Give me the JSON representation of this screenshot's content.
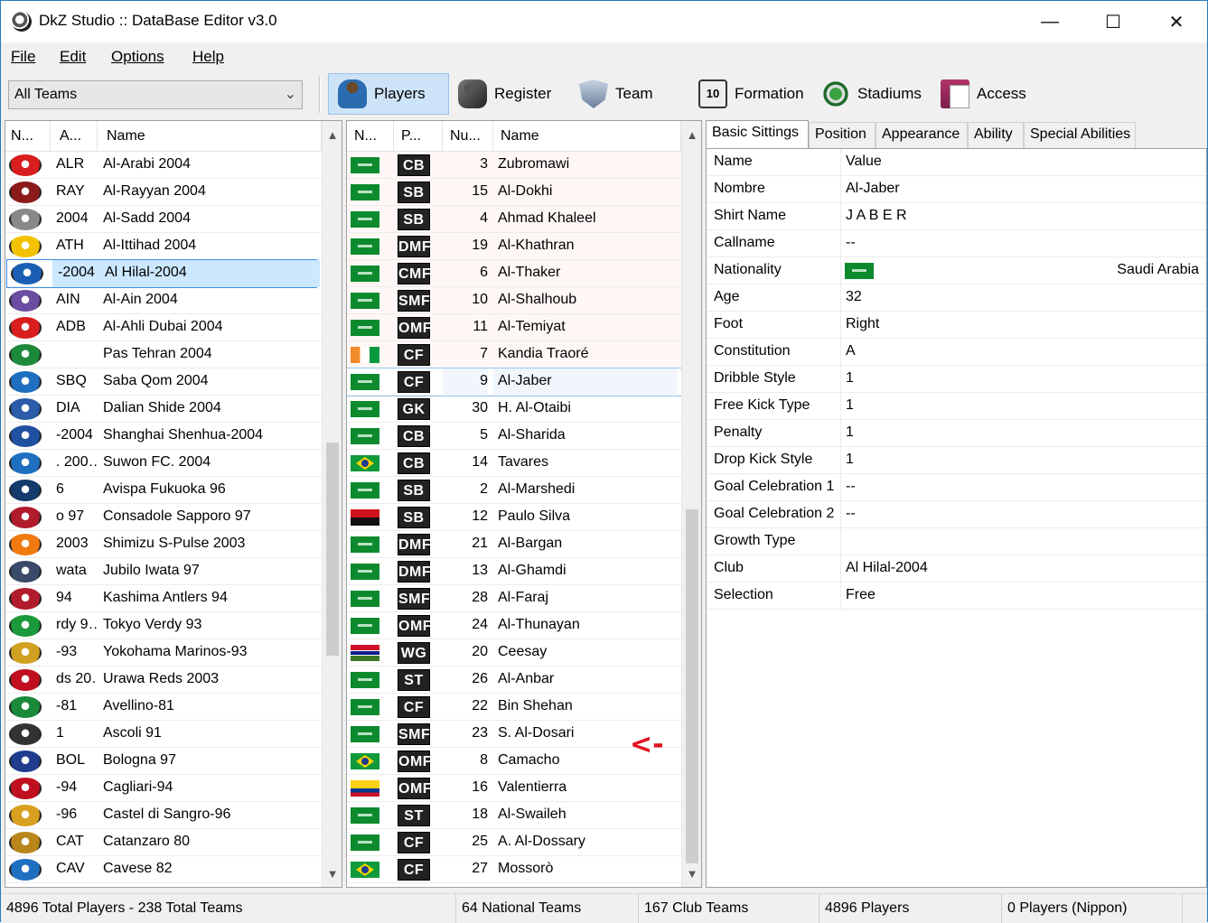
{
  "window": {
    "title": "DkZ Studio :: DataBase Editor v3.0",
    "minimize": "—",
    "maximize": "☐",
    "close": "✕"
  },
  "menu": {
    "file": "File",
    "edit": "Edit",
    "options": "Options",
    "help": "Help"
  },
  "toolbar": {
    "team_filter": "All Teams",
    "players": "Players",
    "register": "Register",
    "team": "Team",
    "formation": "Formation",
    "stadiums": "Stadiums",
    "access": "Access",
    "formation_icon_text": "10"
  },
  "teams_grid": {
    "headers": [
      "N...",
      "A...",
      "Name"
    ],
    "selected_index": 4,
    "rows": [
      {
        "abbr": "ALR",
        "name": "Al-Arabi 2004",
        "color": "#d81e1e"
      },
      {
        "abbr": "RAY",
        "name": "Al-Rayyan 2004",
        "color": "#8b1a1a"
      },
      {
        "abbr": "2004",
        "name": "Al-Sadd 2004",
        "color": "#888888"
      },
      {
        "abbr": "ATH",
        "name": "Al-Ittihad 2004",
        "color": "#f2c200"
      },
      {
        "abbr": "-2004",
        "name": "Al Hilal-2004",
        "color": "#1a5fb4"
      },
      {
        "abbr": "AIN",
        "name": "Al-Ain 2004",
        "color": "#6a4ca0"
      },
      {
        "abbr": "ADB",
        "name": "Al-Ahli Dubai 2004",
        "color": "#d81e1e"
      },
      {
        "abbr": "",
        "name": "Pas Tehran 2004",
        "color": "#1c8a3a"
      },
      {
        "abbr": "SBQ",
        "name": "Saba Qom 2004",
        "color": "#1f6fc0"
      },
      {
        "abbr": "DIA",
        "name": "Dalian Shide 2004",
        "color": "#2a5ca8"
      },
      {
        "abbr": "-2004",
        "name": "Shanghai Shenhua-2004",
        "color": "#2050a0"
      },
      {
        "abbr": ". 200…",
        "name": "Suwon FC. 2004",
        "color": "#1f6fc0"
      },
      {
        "abbr": "6",
        "name": "Avispa Fukuoka 96",
        "color": "#123a6a"
      },
      {
        "abbr": "o 97",
        "name": "Consadole Sapporo 97",
        "color": "#b01c2c"
      },
      {
        "abbr": "2003",
        "name": "Shimizu S-Pulse 2003",
        "color": "#f07a10"
      },
      {
        "abbr": "wata",
        "name": "Jubilo Iwata 97",
        "color": "#3a4a6a"
      },
      {
        "abbr": "94",
        "name": "Kashima Antlers 94",
        "color": "#b01c2c"
      },
      {
        "abbr": "rdy 9…",
        "name": "Tokyo Verdy 93",
        "color": "#1a9a3a"
      },
      {
        "abbr": "-93",
        "name": "Yokohama Marinos-93",
        "color": "#d0a020"
      },
      {
        "abbr": "ds 20…",
        "name": "Urawa Reds 2003",
        "color": "#c01020"
      },
      {
        "abbr": "-81",
        "name": "Avellino-81",
        "color": "#1a8a3a"
      },
      {
        "abbr": "1",
        "name": "Ascoli 91",
        "color": "#333333"
      },
      {
        "abbr": "BOL",
        "name": "Bologna 97",
        "color": "#1f3c8f"
      },
      {
        "abbr": "-94",
        "name": "Cagliari-94",
        "color": "#c01020"
      },
      {
        "abbr": "-96",
        "name": "Castel di Sangro-96",
        "color": "#d8a020"
      },
      {
        "abbr": "CAT",
        "name": "Catanzaro 80",
        "color": "#b8861a"
      },
      {
        "abbr": "CAV",
        "name": "Cavese 82",
        "color": "#1f6fc0"
      }
    ]
  },
  "players_grid": {
    "headers": [
      "N...",
      "P...",
      "Nu...",
      "Name"
    ],
    "selected_index": 8,
    "rows": [
      {
        "flag": "sa",
        "pos": "CB",
        "num": "3",
        "name": "Zubromawi"
      },
      {
        "flag": "sa",
        "pos": "SB",
        "num": "15",
        "name": "Al-Dokhi"
      },
      {
        "flag": "sa",
        "pos": "SB",
        "num": "4",
        "name": "Ahmad Khaleel"
      },
      {
        "flag": "sa",
        "pos": "DMF",
        "num": "19",
        "name": "Al-Khathran"
      },
      {
        "flag": "sa",
        "pos": "CMF",
        "num": "6",
        "name": "Al-Thaker"
      },
      {
        "flag": "sa",
        "pos": "SMF",
        "num": "10",
        "name": "Al-Shalhoub"
      },
      {
        "flag": "sa",
        "pos": "OMF",
        "num": "11",
        "name": "Al-Temiyat"
      },
      {
        "flag": "ci",
        "pos": "CF",
        "num": "7",
        "name": "Kandia Traoré"
      },
      {
        "flag": "sa",
        "pos": "CF",
        "num": "9",
        "name": "Al-Jaber"
      },
      {
        "flag": "sa",
        "pos": "GK",
        "num": "30",
        "name": "H. Al-Otaibi"
      },
      {
        "flag": "sa",
        "pos": "CB",
        "num": "5",
        "name": "Al-Sharida"
      },
      {
        "flag": "br",
        "pos": "CB",
        "num": "14",
        "name": "Tavares"
      },
      {
        "flag": "sa",
        "pos": "SB",
        "num": "2",
        "name": "Al-Marshedi"
      },
      {
        "flag": "ao",
        "pos": "SB",
        "num": "12",
        "name": "Paulo Silva"
      },
      {
        "flag": "sa",
        "pos": "DMF",
        "num": "21",
        "name": "Al-Bargan"
      },
      {
        "flag": "sa",
        "pos": "DMF",
        "num": "13",
        "name": "Al-Ghamdi"
      },
      {
        "flag": "sa",
        "pos": "SMF",
        "num": "28",
        "name": "Al-Faraj"
      },
      {
        "flag": "sa",
        "pos": "OMF",
        "num": "24",
        "name": "Al-Thunayan"
      },
      {
        "flag": "gm",
        "pos": "WG",
        "num": "20",
        "name": "Ceesay"
      },
      {
        "flag": "sa",
        "pos": "ST",
        "num": "26",
        "name": "Al-Anbar"
      },
      {
        "flag": "sa",
        "pos": "CF",
        "num": "22",
        "name": "Bin Shehan"
      },
      {
        "flag": "sa",
        "pos": "SMF",
        "num": "23",
        "name": "S. Al-Dosari"
      },
      {
        "flag": "br",
        "pos": "OMF",
        "num": "8",
        "name": "Camacho"
      },
      {
        "flag": "co",
        "pos": "OMF",
        "num": "16",
        "name": "Valentierra"
      },
      {
        "flag": "sa",
        "pos": "ST",
        "num": "18",
        "name": "Al-Swaileh"
      },
      {
        "flag": "sa",
        "pos": "CF",
        "num": "25",
        "name": "A. Al-Dossary"
      },
      {
        "flag": "br",
        "pos": "CF",
        "num": "27",
        "name": "Mossorò"
      }
    ]
  },
  "annotation": "<-",
  "tabs": [
    "Basic Sittings",
    "Position",
    "Appearance",
    "Ability",
    "Special Abilities"
  ],
  "properties": [
    {
      "key": "Name",
      "value": "Value"
    },
    {
      "key": "Nombre",
      "value": "Al-Jaber"
    },
    {
      "key": "Shirt Name",
      "value": "J A B E R"
    },
    {
      "key": "Callname",
      "value": "--"
    },
    {
      "key": "Nationality",
      "value": "",
      "flag": "sa",
      "right": "Saudi Arabia"
    },
    {
      "key": "Age",
      "value": "32"
    },
    {
      "key": "Foot",
      "value": "Right"
    },
    {
      "key": "Constitution",
      "value": "A"
    },
    {
      "key": "Dribble Style",
      "value": "1"
    },
    {
      "key": "Free Kick Type",
      "value": "1"
    },
    {
      "key": "Penalty",
      "value": "1"
    },
    {
      "key": "Drop Kick Style",
      "value": "1"
    },
    {
      "key": "Goal Celebration 1",
      "value": "--"
    },
    {
      "key": "Goal Celebration 2",
      "value": "--"
    },
    {
      "key": "Growth Type",
      "value": ""
    },
    {
      "key": "Club",
      "value": "Al Hilal-2004"
    },
    {
      "key": "Selection",
      "value": "Free"
    }
  ],
  "status": {
    "totals": "4896 Total Players  -  238 Total Teams",
    "national": "64 National Teams",
    "club": "167 Club Teams",
    "players": "4896 Players",
    "nippon": "0 Players (Nippon)"
  }
}
